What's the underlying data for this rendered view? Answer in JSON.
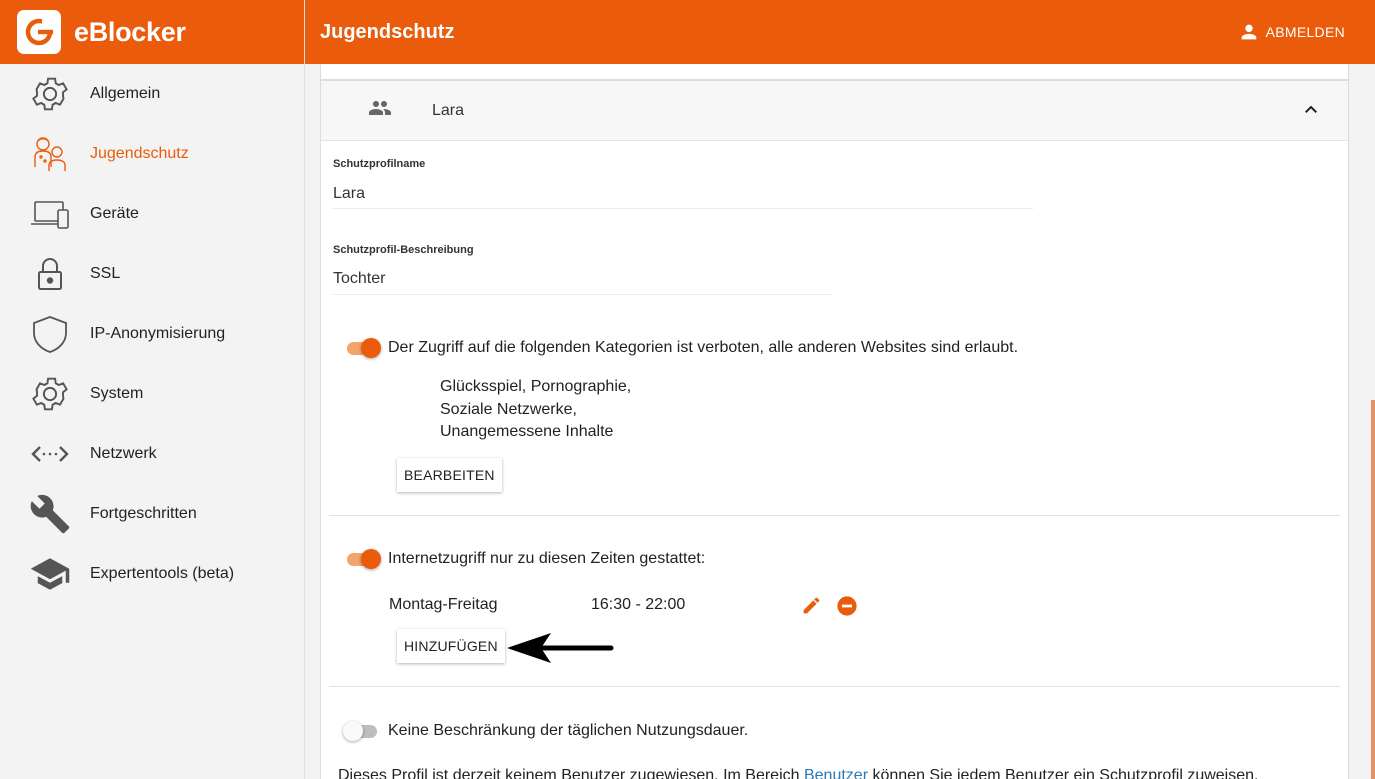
{
  "app": {
    "name": "eBlocker"
  },
  "header": {
    "title": "Jugendschutz",
    "logout_label": "ABMELDEN"
  },
  "sidebar": {
    "items": [
      {
        "label": "Allgemein",
        "icon": "gear-icon"
      },
      {
        "label": "Jugendschutz",
        "icon": "family-icon",
        "active": true
      },
      {
        "label": "Geräte",
        "icon": "devices-icon"
      },
      {
        "label": "SSL",
        "icon": "lock-icon"
      },
      {
        "label": "IP-Anonymisierung",
        "icon": "shield-icon"
      },
      {
        "label": "System",
        "icon": "gear-icon"
      },
      {
        "label": "Netzwerk",
        "icon": "network-icon"
      },
      {
        "label": "Fortgeschritten",
        "icon": "wrench-icon"
      },
      {
        "label": "Expertentools (beta)",
        "icon": "graduation-cap-icon"
      }
    ]
  },
  "profile_card": {
    "header_name": "Lara",
    "name_label": "Schutzprofilname",
    "name_value": "Lara",
    "description_label": "Schutzprofil-Beschreibung",
    "description_value": "Tochter",
    "block_toggle_on": true,
    "block_text": "Der Zugriff auf die folgenden Kategorien ist verboten, alle anderen Websites sind erlaubt.",
    "categories_line1": "Glücksspiel,  Pornographie,",
    "categories_line2": "Soziale Netzwerke,",
    "categories_line3": "Unangemessene Inhalte",
    "edit_button": "BEARBEITEN",
    "time_toggle_on": true,
    "time_text": "Internetzugriff nur zu diesen Zeiten gestattet:",
    "schedule": [
      {
        "days": "Montag-Freitag",
        "time": "16:30 - 22:00"
      }
    ],
    "add_button": "HINZUFÜGEN",
    "usage_toggle_on": false,
    "usage_text": "Keine Beschränkung der täglichen Nutzungsdauer.",
    "footer_prefix": "Dieses Profil ist derzeit keinem Benutzer zugewiesen. Im Bereich ",
    "footer_link": "Benutzer",
    "footer_suffix": " können Sie jedem Benutzer ein Schutzprofil zuweisen."
  },
  "colors": {
    "accent": "#ea5c0c",
    "link": "#2a7ab8"
  }
}
